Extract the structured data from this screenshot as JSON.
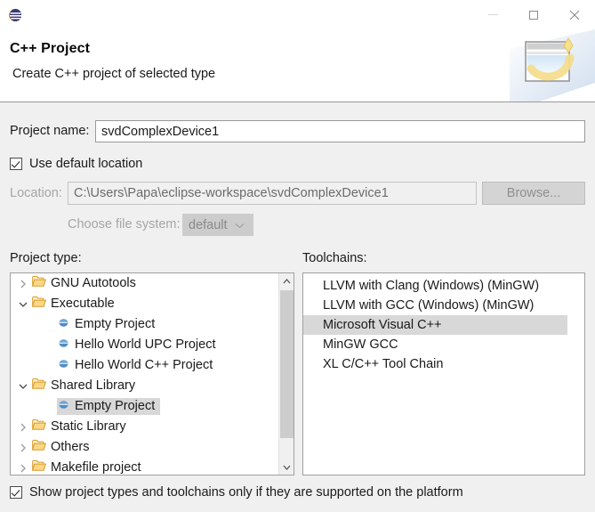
{
  "window": {
    "app_icon": "eclipse-logo-icon",
    "minimize_label": "Minimize",
    "maximize_label": "Maximize",
    "close_label": "Close"
  },
  "header": {
    "title": "C++ Project",
    "subtitle": "Create C++ project of selected type",
    "banner_icon": "wizard-banner-icon"
  },
  "form": {
    "project_name_label": "Project name:",
    "project_name_value": "svdComplexDevice1",
    "project_name_placeholder": "",
    "use_default_location_label": "Use default location",
    "use_default_location_checked": true,
    "location_label": "Location:",
    "location_value": "C:\\Users\\Papa\\eclipse-workspace\\svdComplexDevice1",
    "browse_label": "Browse...",
    "file_system_label": "Choose file system:",
    "file_system_value": "default",
    "file_system_options": [
      "default"
    ]
  },
  "project_type": {
    "label": "Project type:",
    "items": [
      {
        "label": "GNU Autotools",
        "indent": 0,
        "kind": "folder",
        "twisty": "collapsed",
        "selected": false
      },
      {
        "label": "Executable",
        "indent": 0,
        "kind": "folder",
        "twisty": "expanded",
        "selected": false
      },
      {
        "label": "Empty Project",
        "indent": 1,
        "kind": "leaf",
        "twisty": "none",
        "selected": false
      },
      {
        "label": "Hello World UPC Project",
        "indent": 1,
        "kind": "leaf",
        "twisty": "none",
        "selected": false
      },
      {
        "label": "Hello World C++ Project",
        "indent": 1,
        "kind": "leaf",
        "twisty": "none",
        "selected": false
      },
      {
        "label": "Shared Library",
        "indent": 0,
        "kind": "folder",
        "twisty": "expanded",
        "selected": false
      },
      {
        "label": "Empty Project",
        "indent": 1,
        "kind": "leaf",
        "twisty": "none",
        "selected": true
      },
      {
        "label": "Static Library",
        "indent": 0,
        "kind": "folder",
        "twisty": "collapsed",
        "selected": false
      },
      {
        "label": "Others",
        "indent": 0,
        "kind": "folder",
        "twisty": "collapsed",
        "selected": false
      },
      {
        "label": "Makefile project",
        "indent": 0,
        "kind": "folder",
        "twisty": "collapsed",
        "selected": false
      }
    ]
  },
  "toolchains": {
    "label": "Toolchains:",
    "items": [
      {
        "label": "LLVM with Clang (Windows) (MinGW)",
        "selected": false
      },
      {
        "label": "LLVM with GCC (Windows) (MinGW)",
        "selected": false
      },
      {
        "label": "Microsoft Visual C++",
        "selected": true
      },
      {
        "label": "MinGW GCC",
        "selected": false
      },
      {
        "label": "XL C/C++ Tool Chain",
        "selected": false
      }
    ]
  },
  "footer": {
    "show_supported_label": "Show project types and toolchains only if they are supported on the platform",
    "show_supported_checked": true
  },
  "colors": {
    "dialog_bg": "#f0f0f0",
    "header_bg": "#ffffff",
    "selection_bg": "#d8d8d8",
    "folder_icon": "#f0b429",
    "leaf_icon": "#3c78b4",
    "text": "#1a1a1a",
    "disabled_text": "#a6a6a6"
  }
}
